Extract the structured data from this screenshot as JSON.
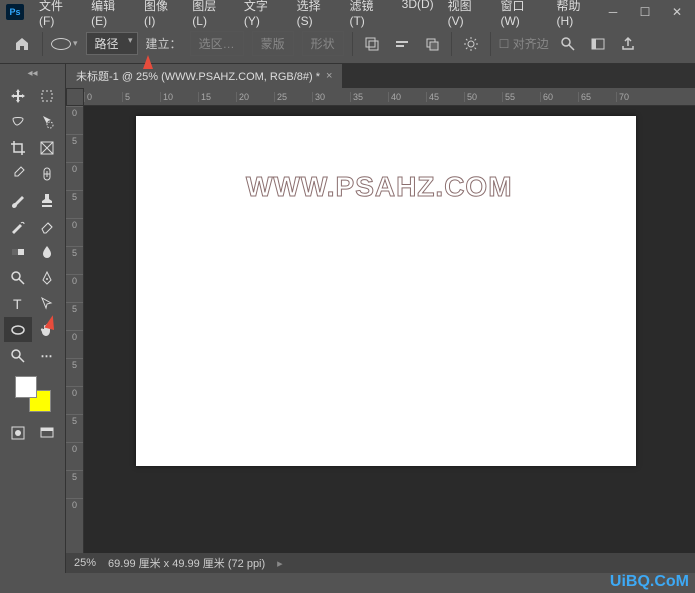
{
  "menubar": {
    "file": "文件(F)",
    "edit": "编辑(E)",
    "image": "图像(I)",
    "layer": "图层(L)",
    "type": "文字(Y)",
    "select": "选择(S)",
    "filter": "滤镜(T)",
    "threed": "3D(D)",
    "view": "视图(V)",
    "window": "窗口(W)",
    "help": "帮助(H)"
  },
  "options": {
    "mode": "路径",
    "make_label": "建立：",
    "selection": "选区…",
    "mask": "蒙版",
    "shape": "形状",
    "align": "对齐边"
  },
  "document": {
    "tab_title": "未标题-1 @ 25% (WWW.PSAHZ.COM, RGB/8#) *",
    "watermark": "WWW.PSAHZ.COM"
  },
  "ruler_h": [
    "0",
    "5",
    "10",
    "15",
    "20",
    "25",
    "30",
    "35",
    "40",
    "45",
    "50",
    "55",
    "60",
    "65",
    "70"
  ],
  "ruler_v": [
    "0",
    "5",
    "0",
    "5",
    "0",
    "5",
    "0",
    "5",
    "0",
    "5",
    "0",
    "5",
    "0",
    "5",
    "0"
  ],
  "statusbar": {
    "zoom": "25%",
    "dims": "69.99 厘米 x 49.99 厘米 (72 ppi)"
  },
  "colors": {
    "foreground": "#ffffff",
    "background": "#ffff00"
  },
  "brand": "UiBQ.CoM"
}
